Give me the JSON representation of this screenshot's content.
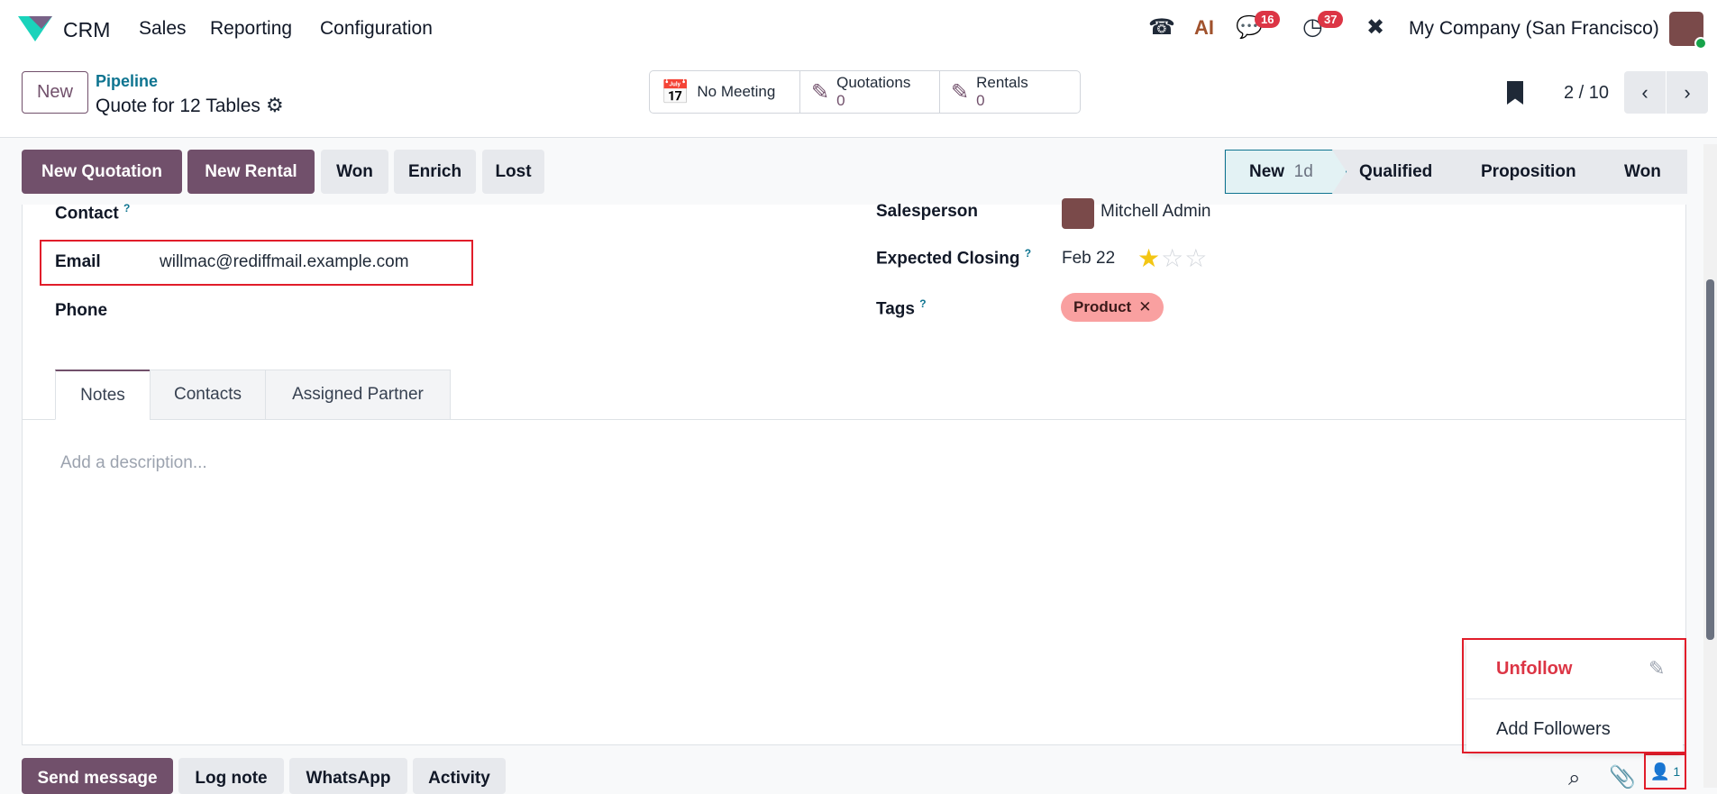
{
  "nav": {
    "app": "CRM",
    "menu": [
      "Sales",
      "Reporting",
      "Configuration"
    ],
    "messages_count": "16",
    "activities_count": "37",
    "ai_label": "AI",
    "company": "My Company (San Francisco)"
  },
  "control": {
    "new_label": "New",
    "breadcrumb": "Pipeline",
    "title": "Quote for 12 Tables",
    "stats": [
      {
        "label": "No Meeting"
      },
      {
        "label": "Quotations",
        "value": "0"
      },
      {
        "label": "Rentals",
        "value": "0"
      }
    ],
    "pager": "2 / 10"
  },
  "actions": [
    "New Quotation",
    "New Rental",
    "Won",
    "Enrich",
    "Lost"
  ],
  "stages": [
    {
      "label": "New",
      "duration": "1d"
    },
    {
      "label": "Qualified"
    },
    {
      "label": "Proposition"
    },
    {
      "label": "Won"
    }
  ],
  "form": {
    "contact_label": "Contact",
    "email_label": "Email",
    "email_value": "willmac@rediffmail.example.com",
    "phone_label": "Phone",
    "salesperson_label": "Salesperson",
    "salesperson_value": "Mitchell Admin",
    "closing_label": "Expected Closing",
    "closing_value": "Feb 22",
    "priority_stars": 1,
    "priority_max": 3,
    "tags_label": "Tags",
    "tag": "Product",
    "help": "?"
  },
  "tabs": [
    "Notes",
    "Contacts",
    "Assigned Partner"
  ],
  "notes_placeholder": "Add a description...",
  "chatter": {
    "buttons": [
      "Send message",
      "Log note",
      "WhatsApp",
      "Activity"
    ],
    "followers_count": "1"
  },
  "followers_menu": {
    "unfollow": "Unfollow",
    "add": "Add Followers"
  },
  "colors": {
    "brand": "#71506b",
    "highlight": "#e11d2a",
    "tag": "#f9a0a0"
  }
}
